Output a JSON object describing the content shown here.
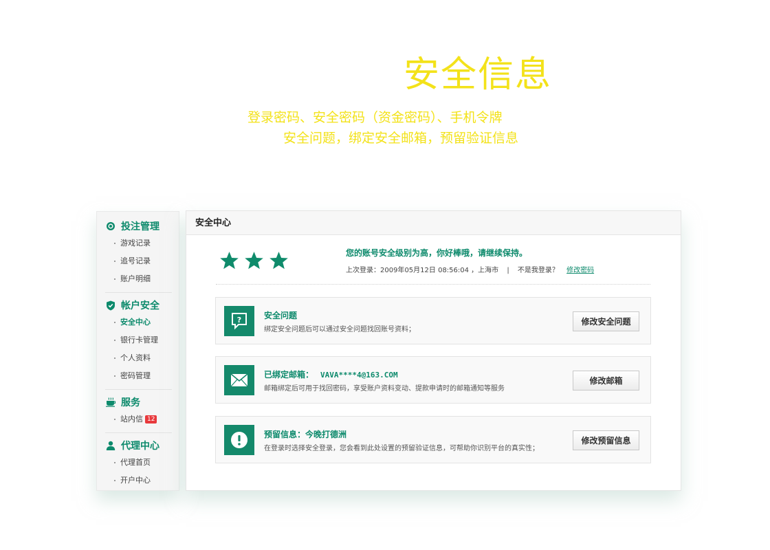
{
  "hero": {
    "title": "安全信息",
    "line1": "登录密码、安全密码（资金密码）、手机令牌",
    "line2": "安全问题，绑定安全邮箱，预留验证信息"
  },
  "sidebar": {
    "groups": [
      {
        "title": "投注管理",
        "icon": "target-icon",
        "items": [
          "游戏记录",
          "追号记录",
          "账户明细"
        ]
      },
      {
        "title": "帐户安全",
        "icon": "shield-icon",
        "items": [
          "安全中心",
          "银行卡管理",
          "个人资料",
          "密码管理"
        ],
        "active": "安全中心"
      },
      {
        "title": "服务",
        "icon": "coffee-cup-icon",
        "items": [
          "站内信"
        ],
        "badge": "12"
      },
      {
        "title": "代理中心",
        "icon": "user-icon",
        "items": [
          "代理首页",
          "开户中心"
        ]
      }
    ]
  },
  "panel": {
    "title": "安全中心",
    "stars": 3,
    "level_text": "您的账号安全级别为高，你好棒哦，请继续保持。",
    "login_label": "上次登录：2009年05月12日 08:56:04 ，上海市",
    "separator": "|",
    "not_me": "不是我登录？",
    "change_password": "修改密码",
    "cards": [
      {
        "icon": "question-icon",
        "title": "安全问题",
        "desc": "绑定安全问题后可以通过安全问题找回账号资料；",
        "button": "修改安全问题"
      },
      {
        "icon": "envelope-icon",
        "title": "已绑定邮箱：",
        "email": "VAVA****4@163.COM",
        "desc": "邮箱绑定后可用于找回密码，享受账户资料变动、提款申请时的邮箱通知等服务",
        "button": "修改邮箱"
      },
      {
        "icon": "exclamation-icon",
        "title": "预留信息：今晚打德洲",
        "desc": "在登录时选择安全登录，您会看到此处设置的预留验证信息，可帮助你识别平台的真实性；",
        "button": "修改预留信息"
      }
    ]
  },
  "colors": {
    "accent": "#0d8a6c",
    "hero": "#f3e21a",
    "badge": "#e8393c"
  }
}
